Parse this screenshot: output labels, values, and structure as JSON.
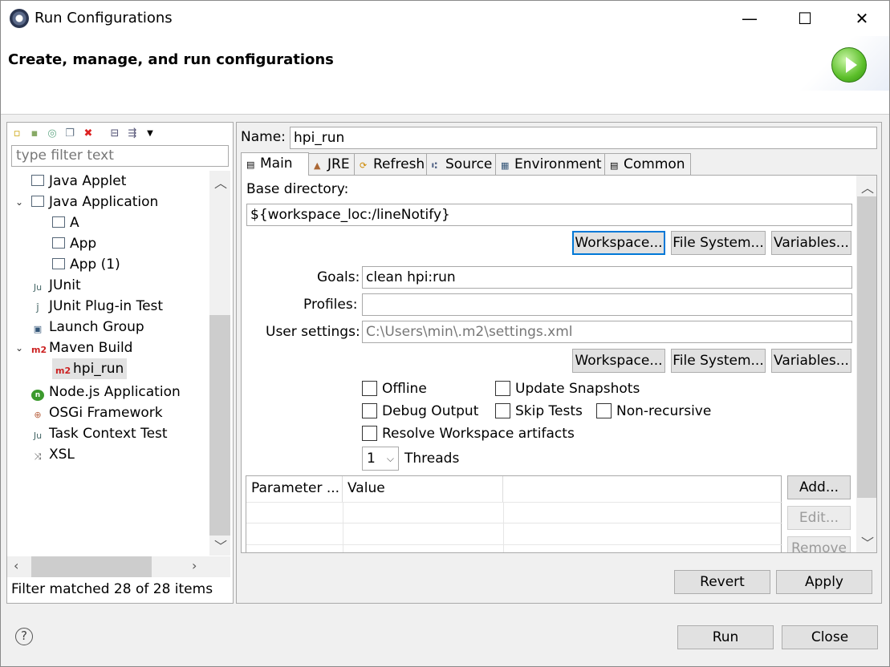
{
  "window": {
    "title": "Run Configurations",
    "controls": {
      "minimize": "—",
      "maximize": "☐",
      "close": "✕"
    }
  },
  "banner": {
    "title": "Create, manage, and run configurations"
  },
  "left": {
    "filter_placeholder": "type filter text",
    "tree": [
      {
        "label": "Java Applet",
        "level": 0,
        "icon": "java-applet-icon"
      },
      {
        "label": "Java Application",
        "level": 0,
        "icon": "java-application-icon",
        "expanded": true
      },
      {
        "label": "A",
        "level": 1,
        "icon": "java-application-icon"
      },
      {
        "label": "App",
        "level": 1,
        "icon": "java-application-icon"
      },
      {
        "label": "App (1)",
        "level": 1,
        "icon": "java-application-icon"
      },
      {
        "label": "JUnit",
        "level": 0,
        "icon": "junit-icon"
      },
      {
        "label": "JUnit Plug-in Test",
        "level": 0,
        "icon": "junit-plugin-icon"
      },
      {
        "label": "Launch Group",
        "level": 0,
        "icon": "launch-group-icon"
      },
      {
        "label": "Maven Build",
        "level": 0,
        "icon": "maven-icon",
        "expanded": true
      },
      {
        "label": "hpi_run",
        "level": 1,
        "icon": "maven-icon",
        "selected": true
      },
      {
        "label": "Node.js Application",
        "level": 0,
        "icon": "nodejs-icon"
      },
      {
        "label": "OSGi Framework",
        "level": 0,
        "icon": "osgi-icon"
      },
      {
        "label": "Task Context Test",
        "level": 0,
        "icon": "task-context-icon"
      },
      {
        "label": "XSL",
        "level": 0,
        "icon": "xsl-icon"
      }
    ],
    "status": "Filter matched 28 of 28 items"
  },
  "config": {
    "name_label": "Name:",
    "name_value": "hpi_run",
    "tabs": [
      {
        "label": "Main",
        "icon": "main-tab-icon",
        "active": true
      },
      {
        "label": "JRE",
        "icon": "jre-icon"
      },
      {
        "label": "Refresh",
        "icon": "refresh-icon"
      },
      {
        "label": "Source",
        "icon": "source-icon"
      },
      {
        "label": "Environment",
        "icon": "environment-icon"
      },
      {
        "label": "Common",
        "icon": "common-icon"
      }
    ],
    "base_dir_label": "Base directory:",
    "base_dir_value": "${workspace_loc:/lineNotify}",
    "workspace_button": "Workspace...",
    "filesystem_button": "File System...",
    "variables_button": "Variables...",
    "goals_label": "Goals:",
    "goals_value": "clean hpi:run",
    "profiles_label": "Profiles:",
    "profiles_value": "",
    "user_settings_label": "User settings:",
    "user_settings_value": "C:\\Users\\min\\.m2\\settings.xml",
    "checkboxes": {
      "offline": "Offline",
      "update_snapshots": "Update Snapshots",
      "debug_output": "Debug Output",
      "skip_tests": "Skip Tests",
      "non_recursive": "Non-recursive",
      "resolve_workspace": "Resolve Workspace artifacts"
    },
    "threads_value": "1",
    "threads_label": "Threads",
    "table": {
      "col_parameter": "Parameter ...",
      "col_value": "Value"
    },
    "add_button": "Add...",
    "edit_button": "Edit...",
    "remove_button": "Remove",
    "revert_button": "Revert",
    "apply_button": "Apply"
  },
  "footer": {
    "help": "?",
    "run_button": "Run",
    "close_button": "Close"
  }
}
